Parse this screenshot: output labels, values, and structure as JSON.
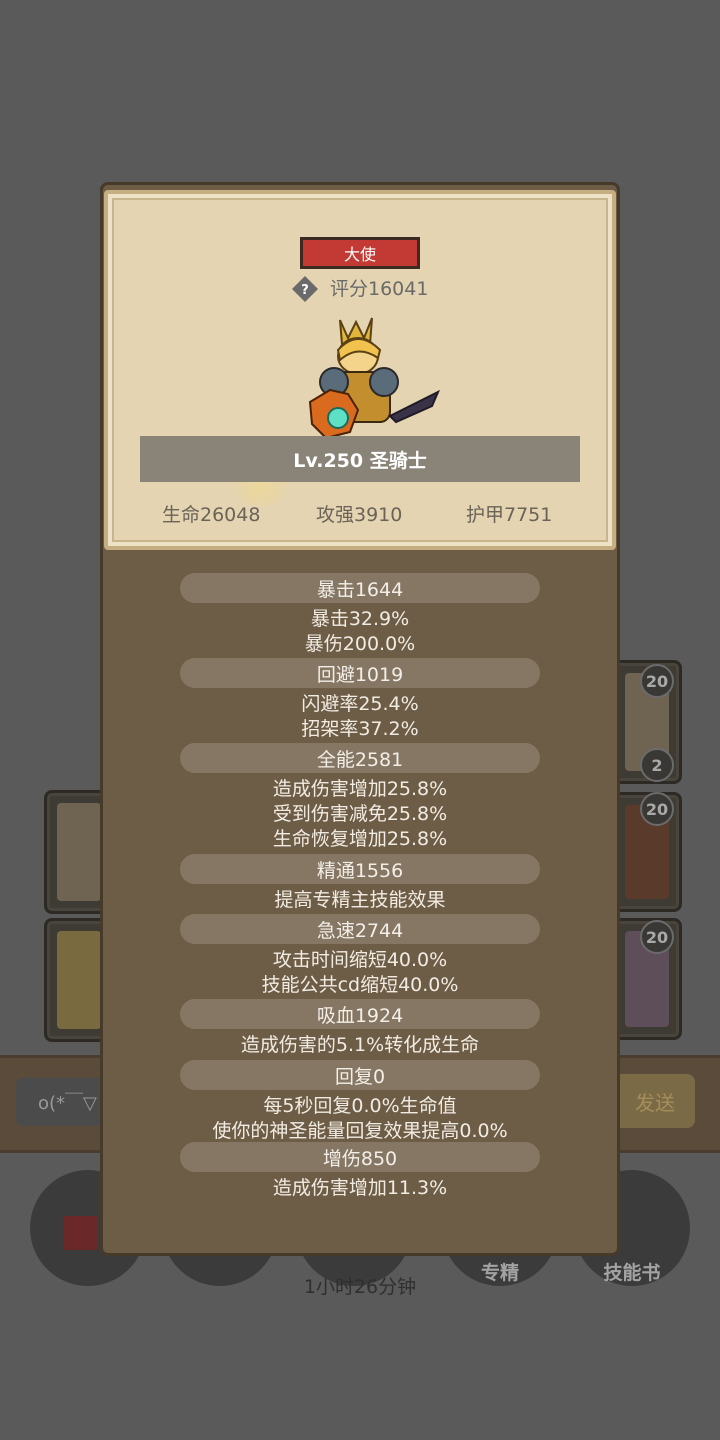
{
  "background": {
    "card_badges": [
      "20",
      "2",
      "20",
      "20"
    ],
    "chat_input": "o(*￣▽",
    "send_label": "发送",
    "bottom_nav": [
      "专精",
      "技能书"
    ],
    "timer": "1小时26分钟"
  },
  "panel": {
    "rank_title": "大使",
    "score": "评分16041",
    "level_class": "Lv.250 圣骑士",
    "hp": "生命26048",
    "attack": "攻强3910",
    "armor": "护甲7751"
  },
  "stats": [
    {
      "title": "暴击1644",
      "lines": [
        "暴击32.9%",
        "暴伤200.0%"
      ]
    },
    {
      "title": "回避1019",
      "lines": [
        "闪避率25.4%",
        "招架率37.2%"
      ]
    },
    {
      "title": "全能2581",
      "lines": [
        "造成伤害增加25.8%",
        "受到伤害减免25.8%",
        "生命恢复增加25.8%"
      ]
    },
    {
      "title": "精通1556",
      "lines": [
        "提高专精主技能效果"
      ]
    },
    {
      "title": "急速2744",
      "lines": [
        "攻击时间缩短40.0%",
        "技能公共cd缩短40.0%"
      ]
    },
    {
      "title": "吸血1924",
      "lines": [
        "造成伤害的5.1%转化成生命"
      ]
    },
    {
      "title": "回复0",
      "lines": [
        "每5秒回复0.0%生命值",
        "使你的神圣能量回复效果提高0.0%"
      ]
    },
    {
      "title": "增伤850",
      "lines": [
        "造成伤害增加11.3%"
      ]
    }
  ],
  "colors": {
    "panel_bg": "#6e5d46",
    "card_bg": "#e4d4b1",
    "badge_red": "#c23a33",
    "group_pill": "#857764"
  }
}
